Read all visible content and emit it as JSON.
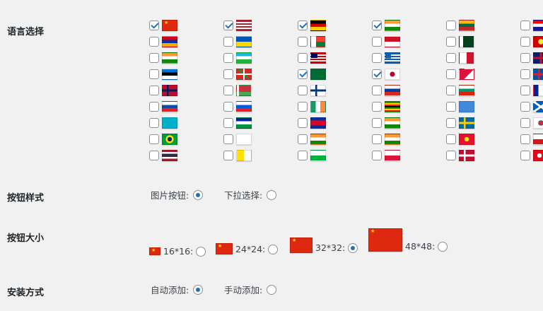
{
  "sections": {
    "languages": {
      "label": "语言选择"
    },
    "button_style": {
      "label": "按钮样式",
      "options": [
        {
          "label": "图片按钮:",
          "selected": true
        },
        {
          "label": "下拉选择:",
          "selected": false
        }
      ]
    },
    "button_size": {
      "label": "按钮大小",
      "options": [
        {
          "label": "16*16:",
          "selected": false
        },
        {
          "label": "24*24:",
          "selected": false
        },
        {
          "label": "32*32:",
          "selected": true
        },
        {
          "label": "48*48:",
          "selected": false
        }
      ]
    },
    "install_method": {
      "label": "安装方式",
      "options": [
        {
          "label": "自动添加:",
          "selected": true
        },
        {
          "label": "手动添加:",
          "selected": false
        }
      ]
    }
  },
  "flag_grid": {
    "rows": [
      [
        [
          "china",
          true
        ],
        [
          "usa",
          true
        ],
        [
          "germany",
          true
        ],
        [
          "india",
          true
        ],
        [
          "lithuania",
          false
        ],
        [
          "croatia",
          false
        ]
      ],
      [
        [
          "armenia",
          false
        ],
        [
          "ukraine",
          false
        ],
        [
          "madagascar",
          false
        ],
        [
          "indonesia",
          false
        ],
        [
          "pakistan",
          false
        ],
        [
          "macedonia",
          false
        ]
      ],
      [
        [
          "india",
          false
        ],
        [
          "uzbekistan",
          false
        ],
        [
          "malaysia",
          false
        ],
        [
          "greece",
          false
        ],
        [
          "malta",
          false
        ],
        [
          "uk",
          false
        ]
      ],
      [
        [
          "estonia",
          false
        ],
        [
          "basque",
          false
        ],
        [
          "saudi-arabia",
          true
        ],
        [
          "japan",
          true
        ],
        [
          "nepal",
          false
        ],
        [
          "iceland",
          false
        ]
      ],
      [
        [
          "norway",
          false
        ],
        [
          "belarus",
          false
        ],
        [
          "finland",
          false
        ],
        [
          "russia",
          false
        ],
        [
          "bulgaria",
          false
        ],
        [
          "france",
          false
        ]
      ],
      [
        [
          "slovakia",
          false
        ],
        [
          "slovenia",
          false
        ],
        [
          "ireland",
          false
        ],
        [
          "zimbabwe",
          false
        ],
        [
          "somalia",
          false
        ],
        [
          "scotland",
          false
        ]
      ],
      [
        [
          "kazakhstan",
          false
        ],
        [
          "lesotho",
          false
        ],
        [
          "cambodia",
          false
        ],
        [
          "india",
          false
        ],
        [
          "sweden",
          false
        ],
        [
          "south-korea",
          false
        ]
      ],
      [
        [
          "brazil",
          false
        ],
        [
          "corsica",
          false
        ],
        [
          "india",
          false
        ],
        [
          "india",
          false
        ],
        [
          "kyrgyzstan",
          false
        ],
        [
          "czech",
          false
        ]
      ],
      [
        [
          "thailand",
          false
        ],
        [
          "vatican",
          false
        ],
        [
          "wales",
          false
        ],
        [
          "poland",
          false
        ],
        [
          "denmark",
          false
        ],
        [
          "turkey",
          false
        ]
      ]
    ]
  },
  "colors": {
    "accent": "#2271b1",
    "background": "#f1f1f1"
  }
}
